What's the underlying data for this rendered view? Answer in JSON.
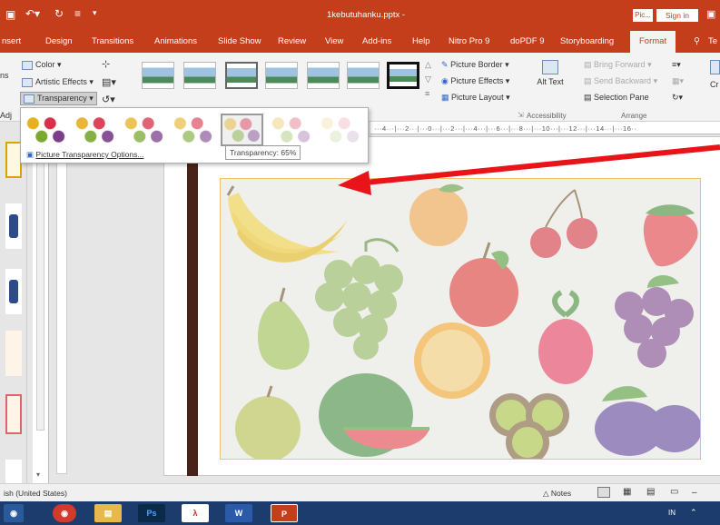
{
  "titlebar": {
    "title": "1kebutuhanku.pptx -",
    "picture_tools_label": "Pic...",
    "sign_in": "Sign in"
  },
  "tabs": [
    "nsert",
    "Design",
    "Transitions",
    "Animations",
    "Slide Show",
    "Review",
    "View",
    "Add-ins",
    "Help",
    "Nitro Pro 9",
    "doPDF 9",
    "Storyboarding",
    "Format",
    "Te"
  ],
  "ribbon": {
    "color": "Color",
    "artistic_effects": "Artistic Effects",
    "transparency": "Transparency",
    "picture_border": "Picture Border",
    "picture_effects": "Picture Effects",
    "picture_layout": "Picture Layout",
    "alt_text": "Alt Text",
    "accessibility": "Accessibility",
    "bring_forward": "Bring Forward",
    "send_backward": "Send Backward",
    "selection_pane": "Selection Pane",
    "arrange": "Arrange",
    "left_fragment": "ns",
    "adj_fragment": "Adj",
    "right_fragment": "Cr"
  },
  "dropdown": {
    "options_label": "Picture Transparency Options...",
    "tooltip": "Transparency: 65%"
  },
  "ruler": {
    "text": "···4···|···2···|···0···|···2···|···4···|···6···|···8···|···10···|···12···|···14···|···16··"
  },
  "statusbar": {
    "language": "ish (United States)",
    "notes": "Notes"
  },
  "taskbar": {
    "ps": "Ps",
    "in": "IN"
  },
  "colors": {
    "brand": "#c43e1c",
    "taskbar": "#1d3c6e",
    "arrow": "#e8141a",
    "frame": "#e9c46a"
  }
}
